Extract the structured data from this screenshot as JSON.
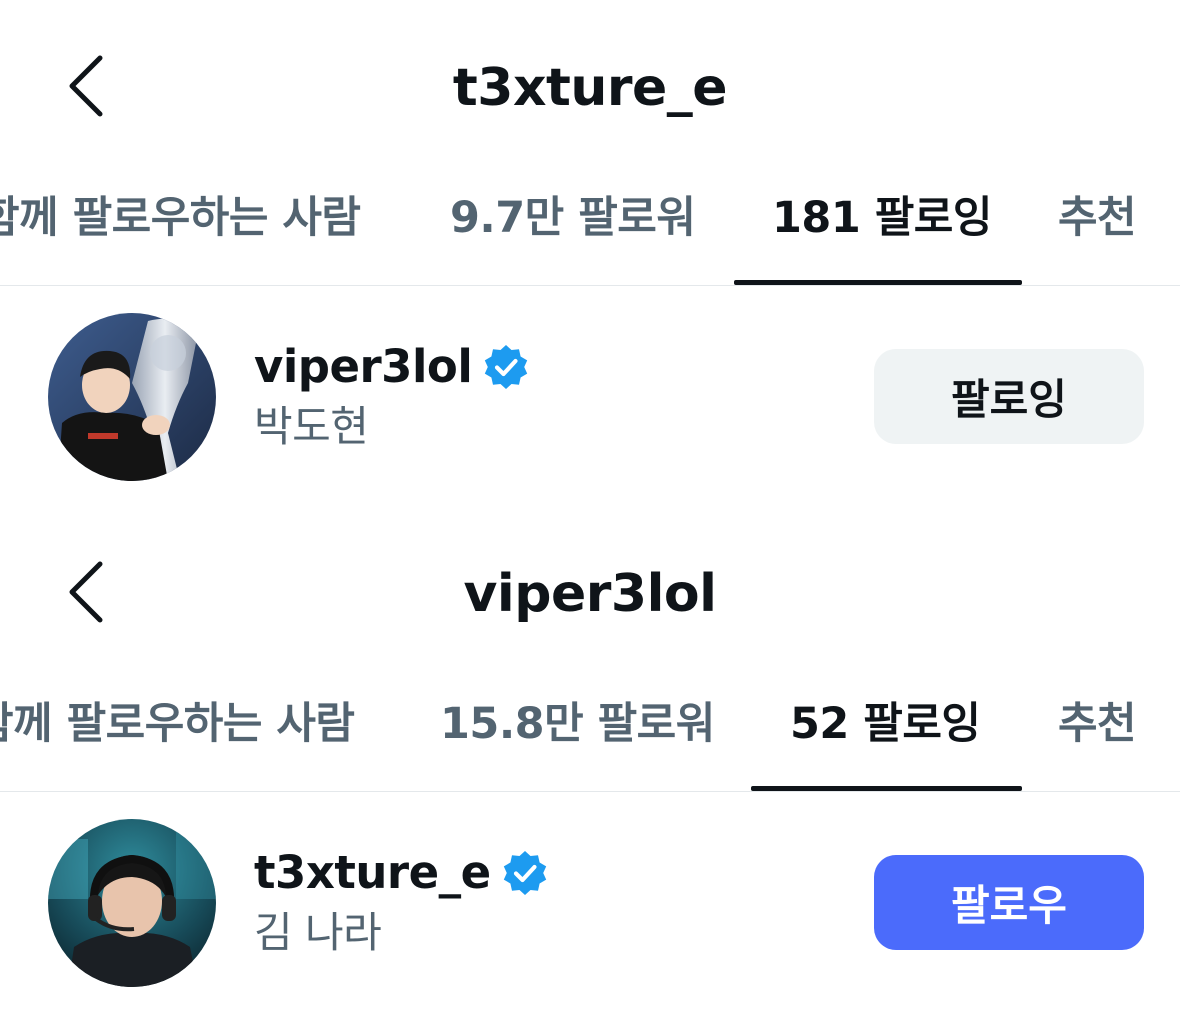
{
  "panels": [
    {
      "header": {
        "title": "t3xture_e"
      },
      "tabs": [
        {
          "label": "함께 팔로우하는 사람"
        },
        {
          "label": "9.7만 팔로워"
        },
        {
          "label": "181 팔로잉",
          "active": true
        },
        {
          "label": "추천"
        }
      ],
      "user": {
        "handle": "viper3lol",
        "name": "박도현",
        "verified": true,
        "button_label": "팔로잉",
        "button_state": "following"
      }
    },
    {
      "header": {
        "title": "viper3lol"
      },
      "tabs": [
        {
          "label": "함께 팔로우하는 사람"
        },
        {
          "label": "15.8만 팔로워"
        },
        {
          "label": "52 팔로잉",
          "active": true
        },
        {
          "label": "추천"
        }
      ],
      "user": {
        "handle": "t3xture_e",
        "name": "김 나라",
        "verified": true,
        "button_label": "팔로우",
        "button_state": "follow"
      }
    }
  ],
  "icons": {
    "back": "chevron-left-icon",
    "verified": "verified-badge-icon"
  },
  "colors": {
    "text_primary": "#0f1419",
    "text_secondary": "#536471",
    "verified_blue": "#1d9bf0",
    "follow_button": "#4b6bfb",
    "following_button": "#eff3f4"
  }
}
